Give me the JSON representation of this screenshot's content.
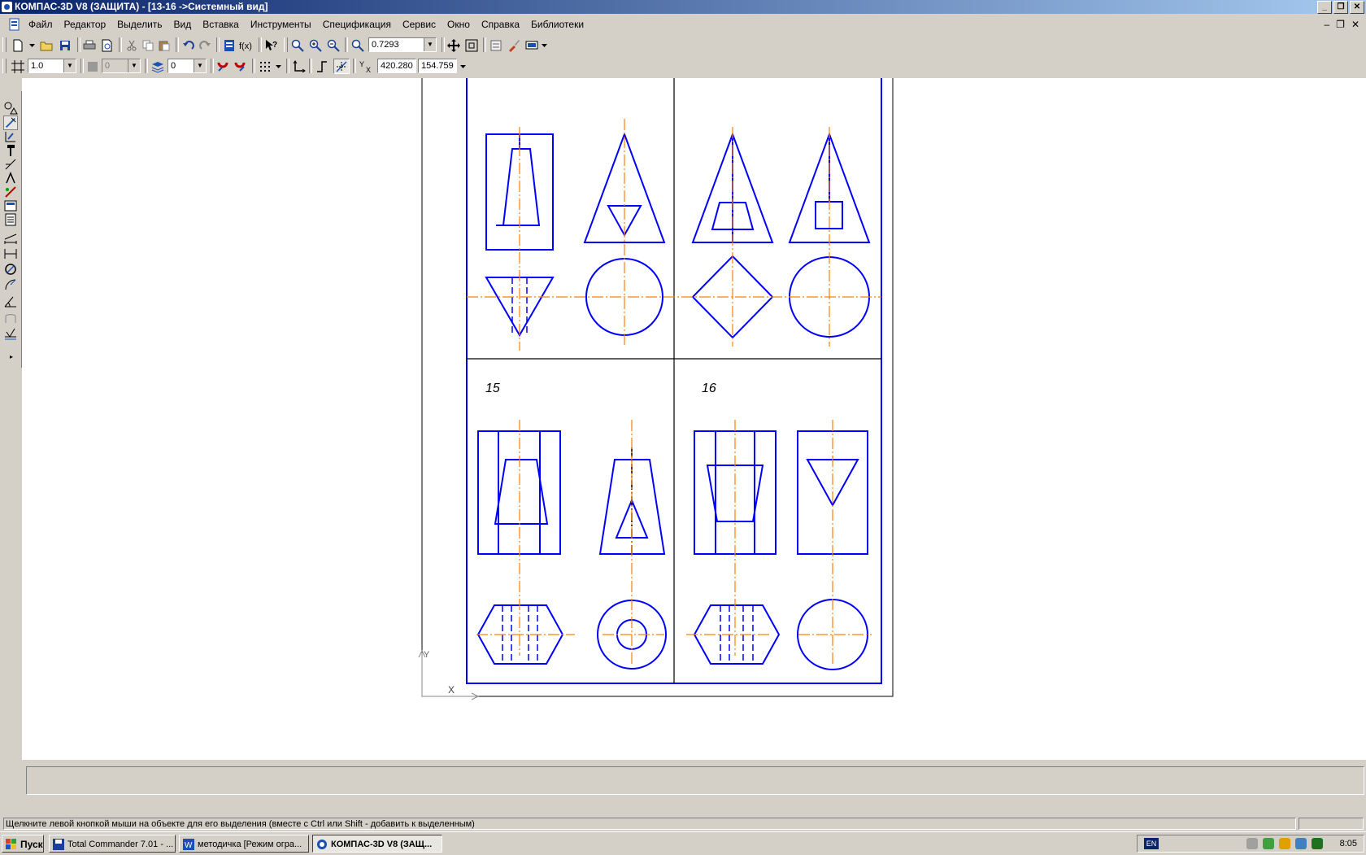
{
  "window": {
    "title": "КОМПАС-3D V8 (ЗАЩИТА) - [13-16 ->Системный вид]",
    "buttons": [
      "_",
      "❐",
      "✕"
    ]
  },
  "menu": {
    "items": [
      "Файл",
      "Редактор",
      "Выделить",
      "Вид",
      "Вставка",
      "Инструменты",
      "Спецификация",
      "Сервис",
      "Окно",
      "Справка",
      "Библиотеки"
    ],
    "doc_buttons": [
      "–",
      "❐",
      "✕"
    ]
  },
  "toolbar": {
    "zoom_value": "0.7293",
    "line_scale": "1.0",
    "layer_state": "0",
    "layer_number": "0",
    "coord_x_label": "Y",
    "coord_x": "420.280",
    "coord_y": "154.759"
  },
  "drawing": {
    "label_15": "15",
    "label_16": "16",
    "axis_y": "Y",
    "axis_x": "X"
  },
  "status": {
    "hint": "Щелкните левой кнопкой мыши на объекте для его выделения (вместе с Ctrl или Shift - добавить к выделенным)"
  },
  "taskbar": {
    "start": "Пуск",
    "tasks": [
      "Total Commander 7.01 - ...",
      "методичка [Режим огра...",
      "КОМПАС-3D V8 (ЗАЩ..."
    ],
    "lang": "EN",
    "clock": "8:05"
  },
  "colors": {
    "shape_blue": "#0000ff",
    "axis_orange": "#ff8000",
    "title_blue": "#0a246a"
  }
}
